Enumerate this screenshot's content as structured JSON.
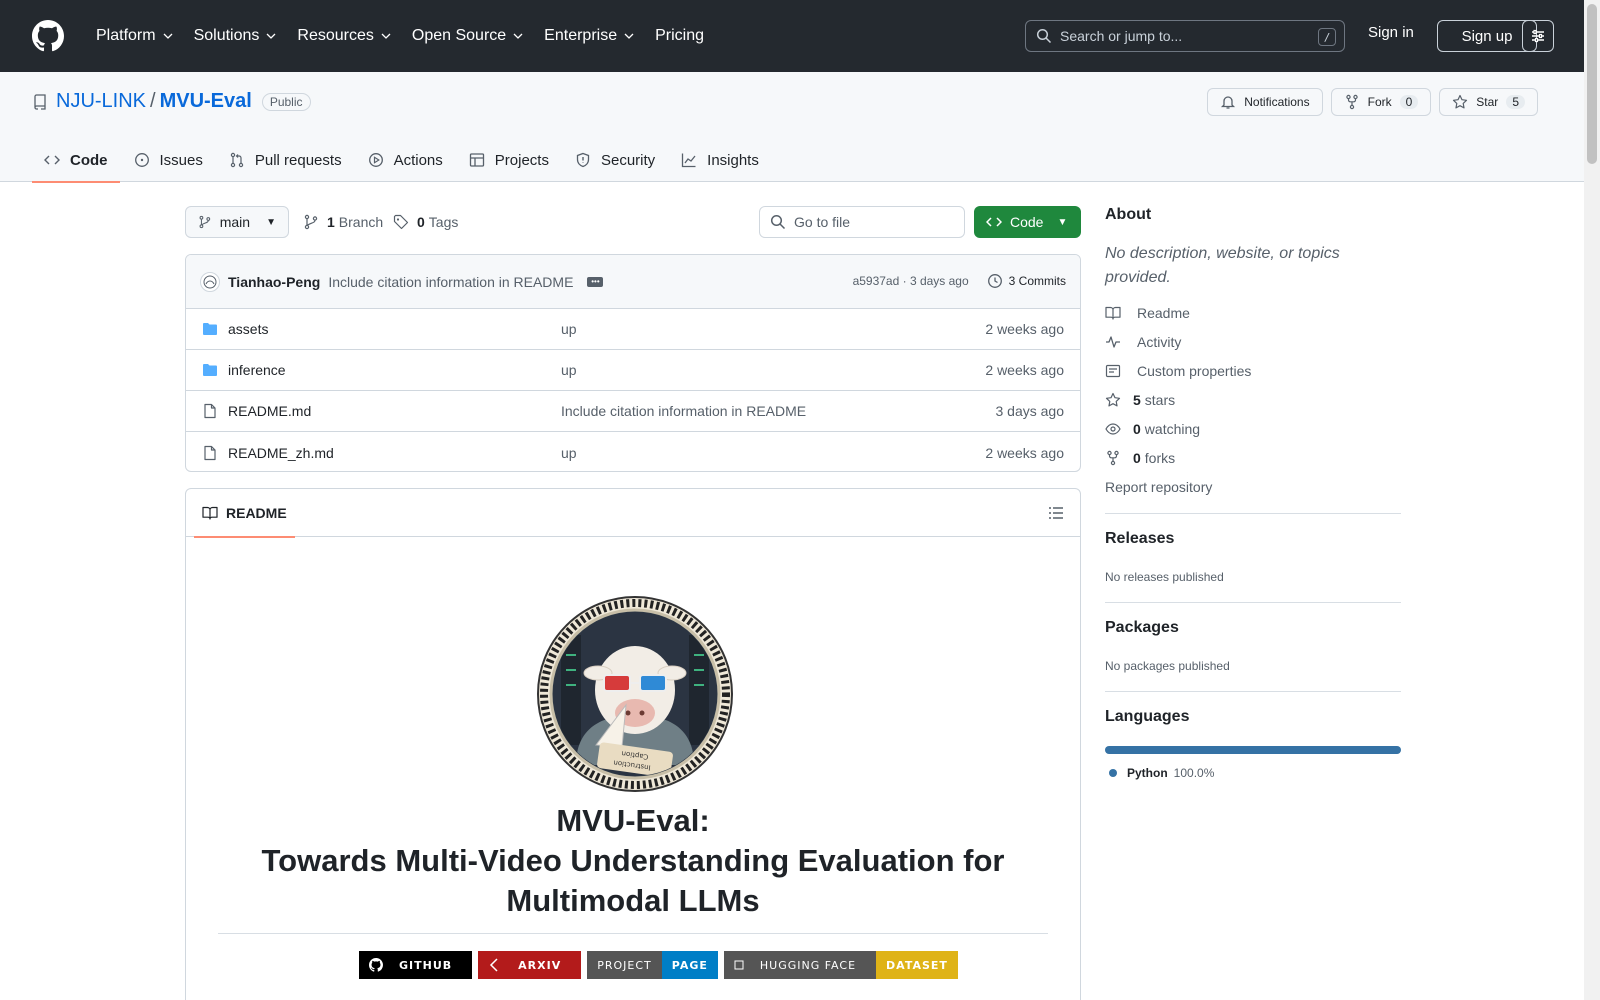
{
  "header": {
    "nav": [
      {
        "label": "Platform",
        "has_menu": true
      },
      {
        "label": "Solutions",
        "has_menu": true
      },
      {
        "label": "Resources",
        "has_menu": true
      },
      {
        "label": "Open Source",
        "has_menu": true
      },
      {
        "label": "Enterprise",
        "has_menu": true
      },
      {
        "label": "Pricing",
        "has_menu": false
      }
    ],
    "search_placeholder": "Search or jump to...",
    "search_shortcut": "/",
    "signin": "Sign in",
    "signup": "Sign up"
  },
  "repo": {
    "owner": "NJU-LINK",
    "separator": "/",
    "name": "MVU-Eval",
    "visibility": "Public",
    "notifications": "Notifications",
    "fork_label": "Fork",
    "fork_count": "0",
    "star_label": "Star",
    "star_count": "5",
    "tabs": [
      {
        "label": "Code",
        "icon": "code-icon"
      },
      {
        "label": "Issues",
        "icon": "issue-icon"
      },
      {
        "label": "Pull requests",
        "icon": "pull-request-icon"
      },
      {
        "label": "Actions",
        "icon": "play-icon"
      },
      {
        "label": "Projects",
        "icon": "table-icon"
      },
      {
        "label": "Security",
        "icon": "shield-icon"
      },
      {
        "label": "Insights",
        "icon": "graph-icon"
      }
    ]
  },
  "branchbar": {
    "branch": "main",
    "branch_count": "1",
    "branch_label": "Branch",
    "tag_count": "0",
    "tag_label": "Tags",
    "goto_placeholder": "Go to file",
    "code_button": "Code"
  },
  "commit": {
    "author": "Tianhao-Peng",
    "message": "Include citation information in README",
    "hash_time": "a5937ad · 3 days ago",
    "commits": "3 Commits"
  },
  "files": [
    {
      "name": "assets",
      "type": "folder",
      "message": "up",
      "date": "2 weeks ago"
    },
    {
      "name": "inference",
      "type": "folder",
      "message": "up",
      "date": "2 weeks ago"
    },
    {
      "name": "README.md",
      "type": "file",
      "message": "Include citation information in README",
      "date": "3 days ago"
    },
    {
      "name": "README_zh.md",
      "type": "file",
      "message": "up",
      "date": "2 weeks ago"
    }
  ],
  "readme": {
    "tab": "README",
    "title_line1": "MVU-Eval:",
    "title_line2": "Towards Multi-Video Understanding Evaluation for",
    "title_line3": "Multimodal LLMs",
    "logo_text_1": "Instruction",
    "logo_text_2": "Caption",
    "badges": [
      {
        "left": "GITHUB",
        "right": "",
        "left_color": "#000000",
        "right_color": ""
      },
      {
        "left": "ARXIV",
        "right": "",
        "left_color": "#b31b1b",
        "right_color": ""
      },
      {
        "left": "PROJECT",
        "right": "PAGE",
        "left_color": "#555555",
        "right_color": "#007ec6"
      },
      {
        "left": "HUGGING FACE",
        "right": "DATASET",
        "left_color": "#555555",
        "right_color": "#dfb317"
      }
    ]
  },
  "sidebar": {
    "about_title": "About",
    "about_desc": "No description, website, or topics provided.",
    "items": [
      {
        "label": "Readme",
        "count": "",
        "icon": "book-icon"
      },
      {
        "label": "Activity",
        "count": "",
        "icon": "pulse-icon"
      },
      {
        "label": "Custom properties",
        "count": "",
        "icon": "note-icon"
      },
      {
        "label": "stars",
        "count": "5",
        "icon": "star-icon"
      },
      {
        "label": "watching",
        "count": "0",
        "icon": "eye-icon"
      },
      {
        "label": "forks",
        "count": "0",
        "icon": "fork-icon"
      }
    ],
    "report": "Report repository",
    "releases_title": "Releases",
    "releases_desc": "No releases published",
    "packages_title": "Packages",
    "packages_desc": "No packages published",
    "languages_title": "Languages",
    "language": {
      "name": "Python",
      "percent": "100.0%",
      "color": "#3572a5"
    }
  }
}
